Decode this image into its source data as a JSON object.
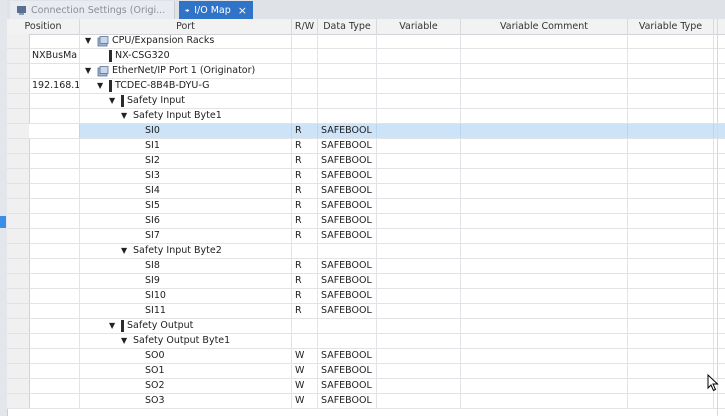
{
  "tabs": {
    "inactive_label": "Connection Settings (Origi...",
    "active_label": "I/O Map",
    "close_glyph": "×"
  },
  "columns": {
    "position": "Position",
    "port": "Port",
    "rw": "R/W",
    "data_type": "Data Type",
    "variable": "Variable",
    "variable_comment": "Variable Comment",
    "variable_type": "Variable Type"
  },
  "rows": [
    {
      "position": "",
      "port": "CPU/Expansion Racks",
      "kind": "rack",
      "indent": 0,
      "expander": "▼",
      "rw": "",
      "type": ""
    },
    {
      "position": "NXBusMa",
      "port": "NX-CSG320",
      "kind": "device",
      "indent": 1,
      "expander": "",
      "rw": "",
      "type": ""
    },
    {
      "position": "",
      "port": "EtherNet/IP Port 1 (Originator)",
      "kind": "rack",
      "indent": 0,
      "expander": "▼",
      "rw": "",
      "type": ""
    },
    {
      "position": "192.168.1",
      "port": "TCDEC-8B4B-DYU-G",
      "kind": "device",
      "indent": 1,
      "expander": "▼",
      "rw": "",
      "type": ""
    },
    {
      "position": "",
      "port": "Safety Input",
      "kind": "device",
      "indent": 2,
      "expander": "▼",
      "rw": "",
      "type": ""
    },
    {
      "position": "",
      "port": "Safety Input Byte1",
      "kind": "group",
      "indent": 3,
      "expander": "▼",
      "rw": "",
      "type": ""
    },
    {
      "position": "",
      "port": "SI0",
      "kind": "io",
      "indent": 4,
      "expander": "",
      "rw": "R",
      "type": "SAFEBOOL",
      "selected": true
    },
    {
      "position": "",
      "port": "SI1",
      "kind": "io",
      "indent": 4,
      "expander": "",
      "rw": "R",
      "type": "SAFEBOOL"
    },
    {
      "position": "",
      "port": "SI2",
      "kind": "io",
      "indent": 4,
      "expander": "",
      "rw": "R",
      "type": "SAFEBOOL"
    },
    {
      "position": "",
      "port": "SI3",
      "kind": "io",
      "indent": 4,
      "expander": "",
      "rw": "R",
      "type": "SAFEBOOL"
    },
    {
      "position": "",
      "port": "SI4",
      "kind": "io",
      "indent": 4,
      "expander": "",
      "rw": "R",
      "type": "SAFEBOOL"
    },
    {
      "position": "",
      "port": "SI5",
      "kind": "io",
      "indent": 4,
      "expander": "",
      "rw": "R",
      "type": "SAFEBOOL"
    },
    {
      "position": "",
      "port": "SI6",
      "kind": "io",
      "indent": 4,
      "expander": "",
      "rw": "R",
      "type": "SAFEBOOL"
    },
    {
      "position": "",
      "port": "SI7",
      "kind": "io",
      "indent": 4,
      "expander": "",
      "rw": "R",
      "type": "SAFEBOOL"
    },
    {
      "position": "",
      "port": "Safety Input Byte2",
      "kind": "group",
      "indent": 3,
      "expander": "▼",
      "rw": "",
      "type": ""
    },
    {
      "position": "",
      "port": "SI8",
      "kind": "io",
      "indent": 4,
      "expander": "",
      "rw": "R",
      "type": "SAFEBOOL"
    },
    {
      "position": "",
      "port": "SI9",
      "kind": "io",
      "indent": 4,
      "expander": "",
      "rw": "R",
      "type": "SAFEBOOL"
    },
    {
      "position": "",
      "port": "SI10",
      "kind": "io",
      "indent": 4,
      "expander": "",
      "rw": "R",
      "type": "SAFEBOOL"
    },
    {
      "position": "",
      "port": "SI11",
      "kind": "io",
      "indent": 4,
      "expander": "",
      "rw": "R",
      "type": "SAFEBOOL"
    },
    {
      "position": "",
      "port": "Safety Output",
      "kind": "device",
      "indent": 2,
      "expander": "▼",
      "rw": "",
      "type": ""
    },
    {
      "position": "",
      "port": "Safety Output Byte1",
      "kind": "group",
      "indent": 3,
      "expander": "▼",
      "rw": "",
      "type": ""
    },
    {
      "position": "",
      "port": "SO0",
      "kind": "io",
      "indent": 4,
      "expander": "",
      "rw": "W",
      "type": "SAFEBOOL"
    },
    {
      "position": "",
      "port": "SO1",
      "kind": "io",
      "indent": 4,
      "expander": "",
      "rw": "W",
      "type": "SAFEBOOL"
    },
    {
      "position": "",
      "port": "SO2",
      "kind": "io",
      "indent": 4,
      "expander": "",
      "rw": "W",
      "type": "SAFEBOOL"
    },
    {
      "position": "",
      "port": "SO3",
      "kind": "io",
      "indent": 4,
      "expander": "",
      "rw": "W",
      "type": "SAFEBOOL"
    }
  ],
  "colors": {
    "active_tab": "#2f74c7",
    "selected_row": "#cde3f8"
  }
}
